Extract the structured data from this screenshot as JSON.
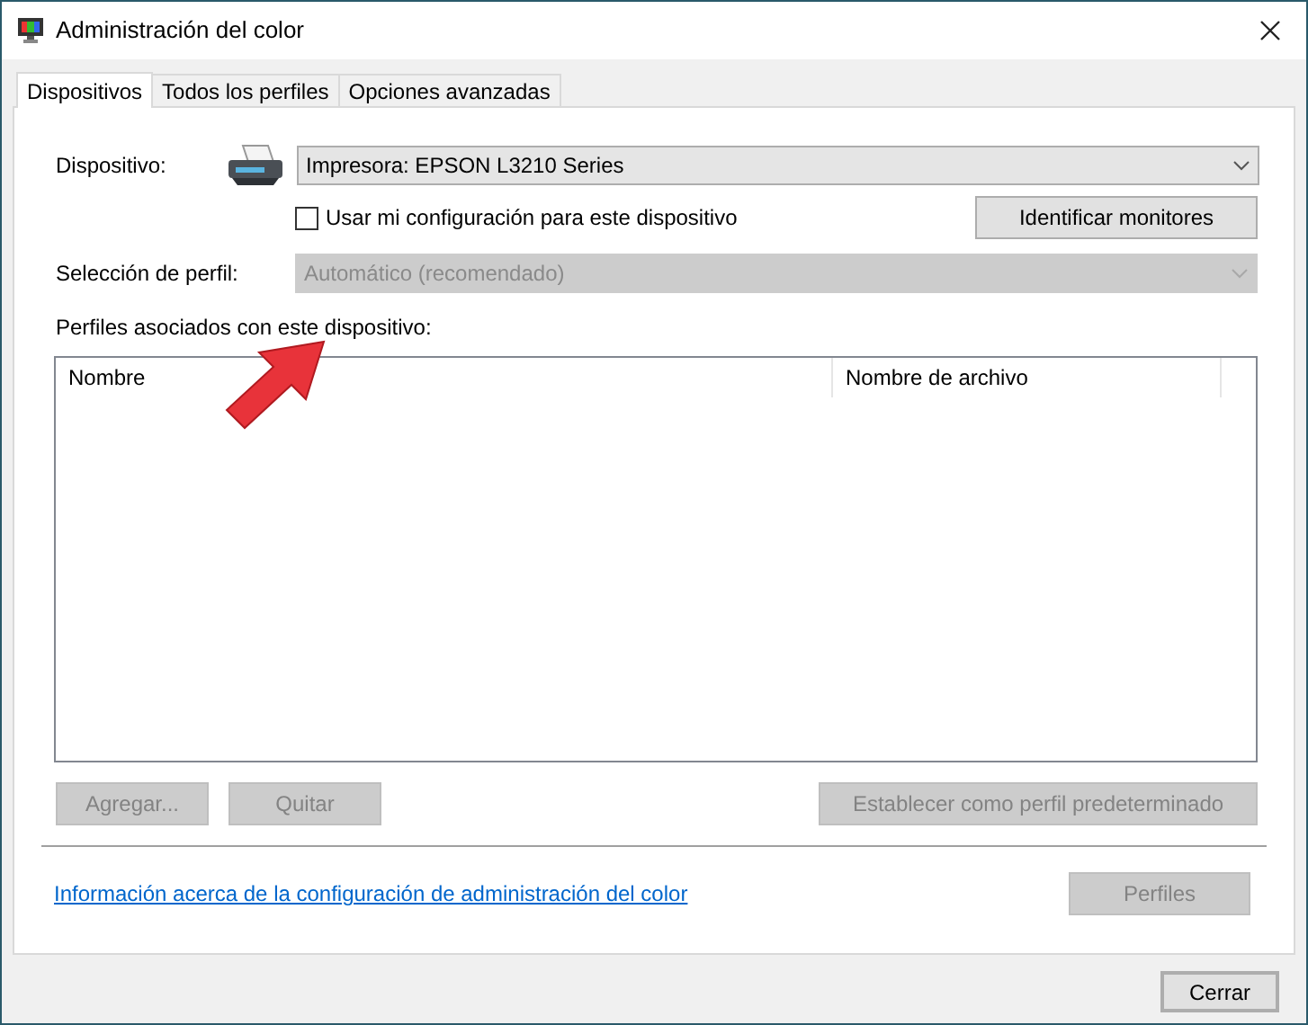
{
  "window": {
    "title": "Administración del color"
  },
  "tabs": [
    {
      "label": "Dispositivos",
      "selected": true
    },
    {
      "label": "Todos los perfiles",
      "selected": false
    },
    {
      "label": "Opciones avanzadas",
      "selected": false
    }
  ],
  "device": {
    "label": "Dispositivo:",
    "value": "Impresora: EPSON L3210 Series"
  },
  "use_my_settings": {
    "label": "Usar mi configuración para este dispositivo",
    "checked": false
  },
  "identify_button": {
    "label": "Identificar monitores",
    "disabled": false
  },
  "profile_selection": {
    "label": "Selección de perfil:",
    "value": "Automático (recomendado)",
    "disabled": true
  },
  "profiles_list": {
    "label": "Perfiles asociados con este dispositivo:",
    "columns": [
      "Nombre",
      "Nombre de archivo"
    ]
  },
  "list_buttons": [
    {
      "label": "Agregar...",
      "disabled": true
    },
    {
      "label": "Quitar",
      "disabled": true
    },
    {
      "label": "Establecer como perfil predeterminado",
      "disabled": true
    }
  ],
  "info_link": "Información acerca de la configuración de administración del color",
  "profiles_button": {
    "label": "Perfiles",
    "disabled": true
  },
  "close_button": {
    "label": "Cerrar",
    "disabled": false
  }
}
